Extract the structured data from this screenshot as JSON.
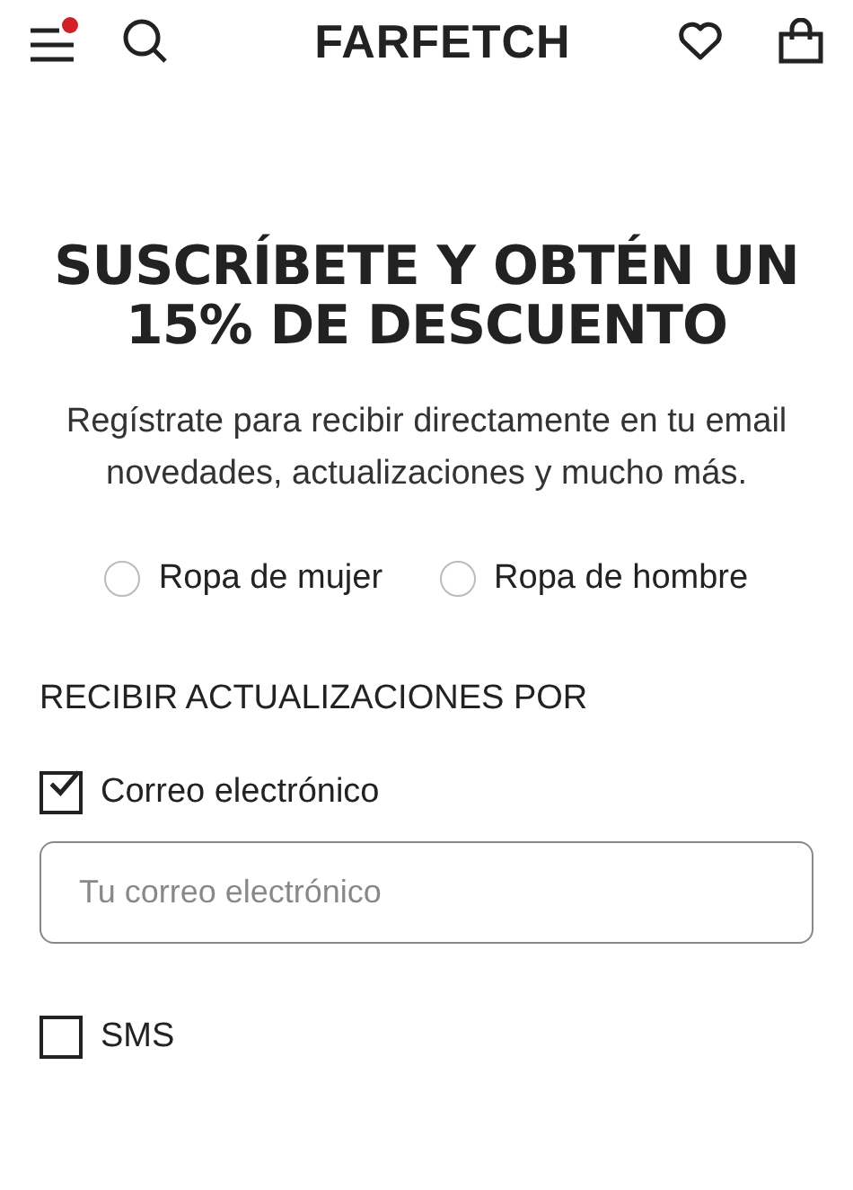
{
  "header": {
    "logo": "FARFETCH"
  },
  "promo": {
    "title": "SUSCRÍBETE Y OBTÉN UN 15% DE DESCUENTO",
    "description": "Regístrate para recibir directamente en tu email novedades, actualizaciones y mucho más."
  },
  "departments": [
    {
      "label": "Ropa de mujer",
      "selected": false
    },
    {
      "label": "Ropa de hombre",
      "selected": false
    }
  ],
  "updates": {
    "heading": "RECIBIR ACTUALIZACIONES POR",
    "options": [
      {
        "kind": "email",
        "label": "Correo electrónico",
        "checked": true,
        "placeholder": "Tu correo electrónico"
      },
      {
        "kind": "sms",
        "label": "SMS",
        "checked": false
      }
    ]
  }
}
